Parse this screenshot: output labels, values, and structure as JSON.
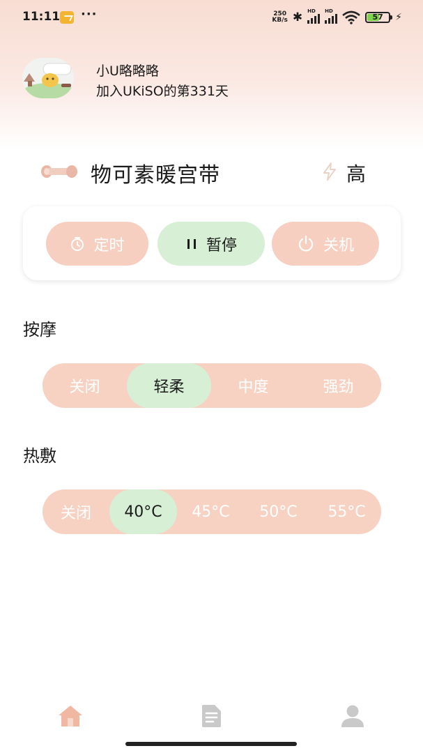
{
  "status_bar": {
    "time": "11:11",
    "more": "···",
    "net_speed_value": "250",
    "net_speed_unit": "KB/s",
    "bluetooth": "✱",
    "battery": "57",
    "battery_level_percent": 57,
    "icons": [
      "notification-icon",
      "bluetooth-icon",
      "signal-hd-icon",
      "wifi-icon",
      "battery-icon",
      "charging-icon"
    ]
  },
  "profile": {
    "name": "小U略略略",
    "days_text": "加入UKiSO的第331天"
  },
  "device": {
    "name": "物可素暖宫带",
    "power_level": "高",
    "icons": [
      "device-belt-icon",
      "lightning-icon"
    ]
  },
  "controls": {
    "timer_label": "定时",
    "pause_label": "暂停",
    "off_label": "关机"
  },
  "massage": {
    "title": "按摩",
    "options": [
      "关闭",
      "轻柔",
      "中度",
      "强劲"
    ],
    "selected": "轻柔"
  },
  "heat": {
    "title": "热敷",
    "options": [
      "关闭",
      "40°C",
      "45°C",
      "50°C",
      "55°C"
    ],
    "selected": "40°C"
  },
  "bottom_nav": {
    "items": [
      "home-icon",
      "document-icon",
      "user-icon"
    ],
    "active": "home-icon"
  },
  "colors": {
    "accent_pink": "#f6cfc0",
    "accent_green": "#d6efd5",
    "nav_active": "#f0b8a3",
    "nav_inactive": "#c8c8c8"
  }
}
